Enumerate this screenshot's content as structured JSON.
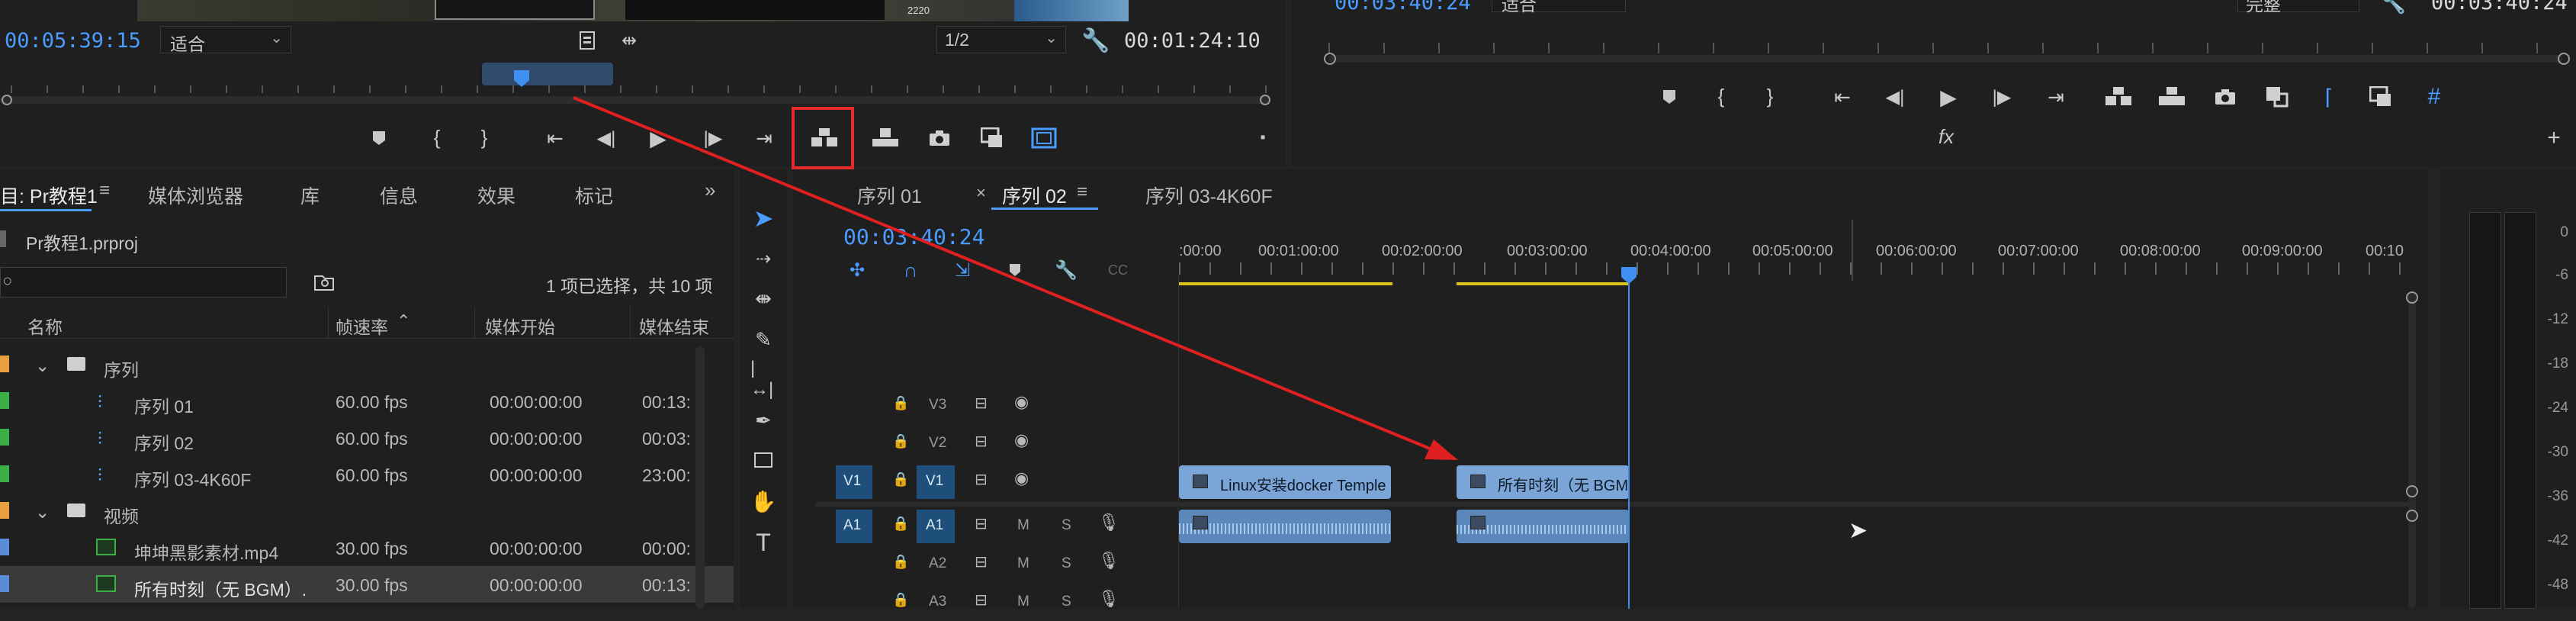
{
  "source_monitor": {
    "timecode": "00:05:39:15",
    "fit": "适合",
    "resolution": "1/2",
    "duration": "00:01:24:10",
    "thumb_number": "2220"
  },
  "program_monitor": {
    "timecode": "00:03:40:24",
    "fit": "适合",
    "quality": "完整",
    "duration": "00:03:40:24"
  },
  "project_panel": {
    "tabs": [
      "目: Pr教程1",
      "媒体浏览器",
      "库",
      "信息",
      "效果",
      "标记"
    ],
    "file": "Pr教程1.prproj",
    "selection": "1 项已选择，共 10 项",
    "columns": [
      "名称",
      "帧速率",
      "媒体开始",
      "媒体结束"
    ],
    "rows": [
      {
        "name": "序列",
        "fps": "",
        "start": "",
        "end": ""
      },
      {
        "name": "序列 01",
        "fps": "60.00 fps",
        "start": "00:00:00:00",
        "end": "00:13:"
      },
      {
        "name": "序列 02",
        "fps": "60.00 fps",
        "start": "00:00:00:00",
        "end": "00:03:"
      },
      {
        "name": "序列 03-4K60F",
        "fps": "60.00 fps",
        "start": "00:00:00:00",
        "end": "23:00:"
      },
      {
        "name": "视频",
        "fps": "",
        "start": "",
        "end": ""
      },
      {
        "name": "坤坤黑影素材.mp4",
        "fps": "30.00 fps",
        "start": "00:00:00:00",
        "end": "00:00:"
      },
      {
        "name": "所有时刻（无 BGM）.",
        "fps": "30.00 fps",
        "start": "00:00:00:00",
        "end": "00:13:"
      }
    ]
  },
  "timeline": {
    "tabs": [
      "序列 01",
      "序列 02",
      "序列 03-4K60F"
    ],
    "timecode": "00:03:40:24",
    "ruler": [
      ":00:00",
      "00:01:00:00",
      "00:02:00:00",
      "00:03:00:00",
      "00:04:00:00",
      "00:05:00:00",
      "00:06:00:00",
      "00:07:00:00",
      "00:08:00:00",
      "00:09:00:00",
      "00:10"
    ],
    "tracks": {
      "v3": "V3",
      "v2": "V2",
      "v1": "V1",
      "a1": "A1",
      "a2": "A2",
      "a3": "A3",
      "src_v": "V1",
      "src_a": "A1",
      "m": "M",
      "s": "S"
    },
    "clips": {
      "clip1": "Linux安装docker Temple",
      "clip2": "所有时刻（无 BGM"
    }
  },
  "meter": {
    "labels": [
      "0",
      "-6",
      "-12",
      "-18",
      "-24",
      "-30",
      "-36",
      "-42",
      "-48"
    ]
  },
  "colors": {
    "accent": "#4a9cff",
    "highlight_box": "#e52b2b",
    "arrow": "#e02020",
    "clip_video": "#7aa5d6",
    "clip_audio": "#6b95c6",
    "track_on": "#1e4f7a",
    "label_orange": "#e8a040",
    "label_green": "#3cae47",
    "label_blue": "#5b8cd6"
  }
}
